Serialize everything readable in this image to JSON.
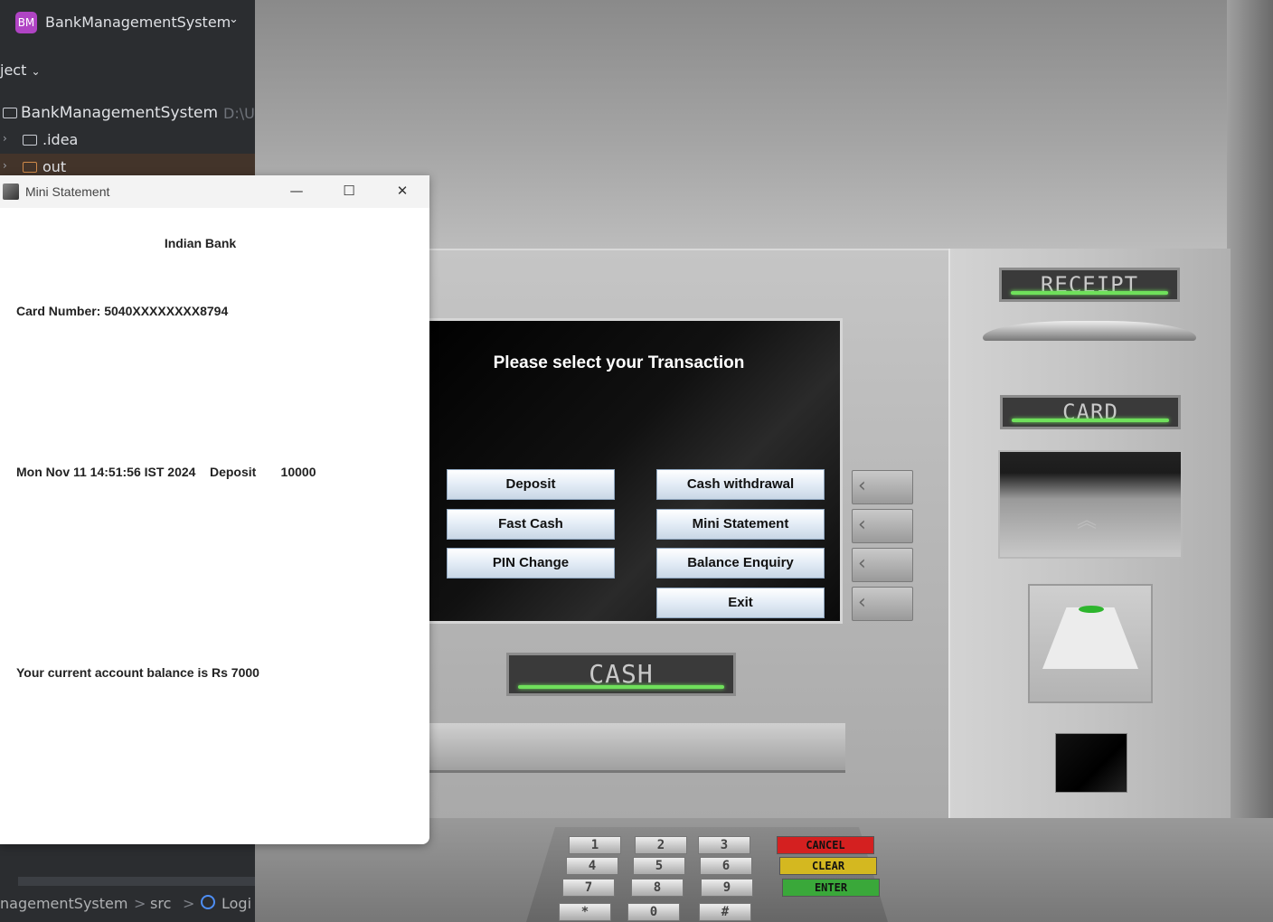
{
  "ide": {
    "project_badge": "BM",
    "project_name": "BankManagementSystem",
    "section_label": "ject",
    "tree": {
      "root_label": "BankManagementSystem",
      "root_path": "D:\\U",
      "idea_label": ".idea",
      "out_label": "out"
    },
    "breadcrumb": {
      "part1": "nagementSystem",
      "sep": ">",
      "part2": "src",
      "part3": "Logi"
    }
  },
  "window": {
    "title": "Mini Statement",
    "minimize": "—",
    "maximize": "☐",
    "close": "✕",
    "bank_name": "Indian Bank",
    "card_number": "Card Number: 5040XXXXXXXX8794",
    "transaction": "Mon Nov 11 14:51:56 IST 2024    Deposit       10000",
    "balance": "Your current account balance is Rs 7000"
  },
  "atm": {
    "screen_title": "Please select your Transaction",
    "buttons": {
      "deposit": "Deposit",
      "cash_withdrawal": "Cash withdrawal",
      "fast_cash": "Fast Cash",
      "mini_statement": "Mini Statement",
      "pin_change": "PIN Change",
      "balance_enquiry": "Balance Enquiry",
      "exit": "Exit"
    },
    "labels": {
      "receipt": "RECEIPT",
      "card": "CARD",
      "cash": "CASH"
    },
    "keypad": {
      "keys": [
        "1",
        "2",
        "3",
        "4",
        "5",
        "6",
        "7",
        "8",
        "9",
        "*",
        "0",
        "#"
      ],
      "cancel": "CANCEL",
      "clear": "CLEAR",
      "enter": "ENTER"
    },
    "colors": {
      "cancel": "#d42020",
      "clear": "#d4b820",
      "enter": "#3aa83a",
      "label_glow": "#6fe05b"
    }
  }
}
